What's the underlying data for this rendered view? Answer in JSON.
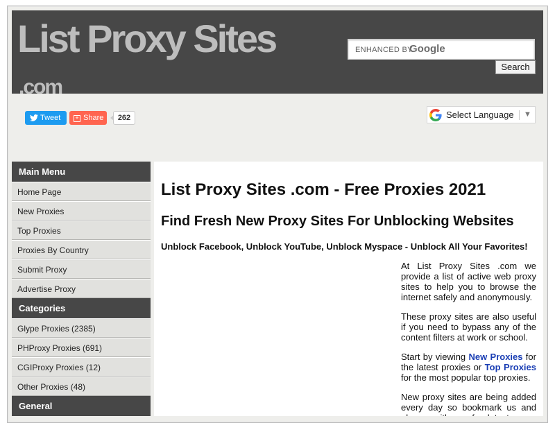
{
  "site": {
    "logo_main": "List Proxy Sites",
    "logo_sub": ".com"
  },
  "search": {
    "enhanced_by": "ENHANCED BY",
    "google_label": "Google",
    "button_label": "Search"
  },
  "social": {
    "tweet_label": "Tweet",
    "share_label": "Share",
    "share_count": "262"
  },
  "language": {
    "select_label": "Select Language",
    "arrow": "▼"
  },
  "sidebar": {
    "main_menu_title": "Main Menu",
    "main_menu": [
      "Home Page",
      "New Proxies",
      "Top Proxies",
      "Proxies By Country",
      "Submit Proxy",
      "Advertise Proxy"
    ],
    "categories_title": "Categories",
    "categories": [
      "Glype Proxies (2385)",
      "PHProxy Proxies (691)",
      "CGIProxy Proxies (12)",
      "Other Proxies (48)"
    ],
    "general_title": "General"
  },
  "main": {
    "title": "List Proxy Sites .com - Free Proxies 2021",
    "subtitle": "Find Fresh New Proxy Sites For Unblocking Websites",
    "tagline": "Unblock Facebook, Unblock YouTube, Unblock Myspace - Unblock All Your Favorites!",
    "para1": "At List Proxy Sites .com we provide a list of active web proxy sites to help you to browse the internet safely and anonymously.",
    "para2": "These proxy sites are also useful if you need to bypass any of the content filters at work or school.",
    "para3_start": "Start by viewing ",
    "para3_link1": "New Proxies",
    "para3_mid": " for the latest proxies or ",
    "para3_link2": "Top Proxies",
    "para3_end": " for the most popular top proxies.",
    "para4": "New proxy sites are being added every day so bookmark us and always with us, for latest proxy news."
  },
  "colors": {
    "header_bg": "#474747",
    "logo_text": "#bdbdbd",
    "link": "#1a3eb4",
    "tweet": "#1d9bf0",
    "share": "#ff6550"
  }
}
